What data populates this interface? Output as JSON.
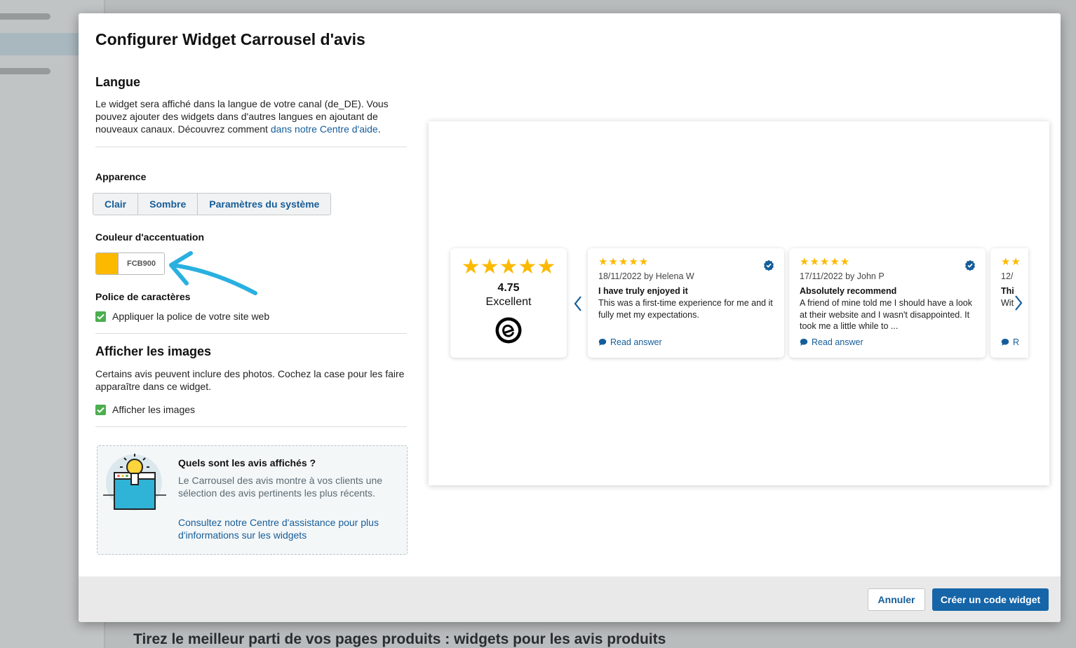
{
  "background": {
    "heading": "Tirez le meilleur parti de vos pages produits : widgets pour les avis produits"
  },
  "modal": {
    "title": "Configurer Widget Carrousel d'avis"
  },
  "language": {
    "title": "Langue",
    "text": "Le widget sera affiché dans la langue de votre canal (de_DE). Vous pouvez ajouter des widgets dans d'autres langues en ajoutant de nouveaux canaux. Découvrez comment ",
    "link": "dans notre Centre d'aide",
    "suffix": "."
  },
  "appearance": {
    "label": "Apparence",
    "options": [
      "Clair",
      "Sombre",
      "Paramètres du système"
    ]
  },
  "accent": {
    "label": "Couleur d'accentuation",
    "value": "FCB900",
    "color": "#FCB900"
  },
  "font": {
    "label": "Police de caractères",
    "checkbox_label": "Appliquer la police de votre site web",
    "checked": true
  },
  "images": {
    "title": "Afficher les images",
    "text": "Certains avis peuvent inclure des photos. Cochez la case pour les faire apparaître dans ce widget.",
    "checkbox_label": "Afficher les images",
    "checked": true
  },
  "info": {
    "title": "Quels sont les avis affichés ?",
    "text": "Le Carrousel des avis montre à vos clients une sélection des avis pertinents les plus récents.",
    "link": "Consultez notre Centre d'assistance pour plus d'informations sur les widgets",
    "icon": "lightbulb-laptop-icon"
  },
  "preview": {
    "summary": {
      "stars": "★★★★★",
      "rating": "4.75",
      "label": "Excellent"
    },
    "reviews": [
      {
        "stars": "★★★★★",
        "meta": "18/11/2022 by Helena W",
        "title": "I have truly enjoyed it",
        "body": "This was a first-time experience for me and it fully met my expectations.",
        "link": "Read answer"
      },
      {
        "stars": "★★★★★",
        "meta": "17/11/2022 by John P",
        "title": "Absolutely recommend",
        "body": "A friend of mine told me I should have a look at their website and I wasn't disappointed. It took me a little while to ...",
        "link": "Read answer"
      },
      {
        "stars": "★★",
        "meta": "12/",
        "title": "Thi",
        "body": "Wit",
        "link": "R"
      }
    ],
    "accent_blue": "#155d99"
  },
  "footer": {
    "cancel": "Annuler",
    "create": "Créer un code widget"
  }
}
